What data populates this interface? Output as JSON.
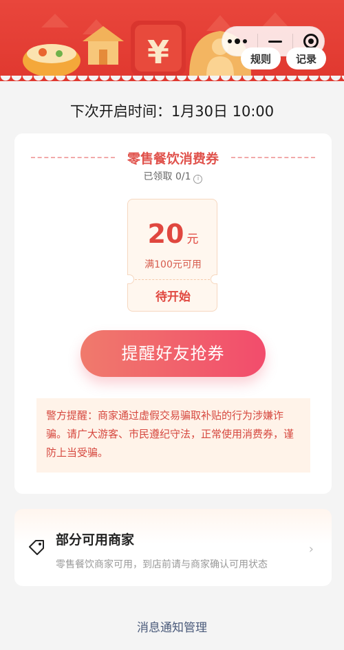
{
  "header": {
    "rules_label": "规则",
    "records_label": "记录",
    "menu_icon": "more-dots-icon",
    "minimize_icon": "minimize-icon",
    "close_icon": "target-icon"
  },
  "schedule": {
    "next_open_time": "下次开启时间：1月30日 10:00"
  },
  "coupon_card": {
    "title": "零售餐饮消费券",
    "claimed": "已领取 0/1",
    "coupon": {
      "amount": "20",
      "unit": "元",
      "condition": "满100元可用",
      "status": "待开始"
    },
    "remind_button": "提醒好友抢券",
    "warning": "警方提醒：商家通过虚假交易骗取补贴的行为涉嫌诈骗。请广大游客、市民遵纪守法，正常使用消费券，谨防上当受骗。"
  },
  "merchants": {
    "title": "部分可用商家",
    "description": "零售餐饮商家可用，到店前请与商家确认可用状态",
    "icon": "tag-icon"
  },
  "footer": {
    "message_manage": "消息通知管理"
  },
  "colors": {
    "banner_red": "#e9463c",
    "accent_red": "#e0473f",
    "button_gradient_start": "#f07a6c",
    "button_gradient_end": "#f24c6c"
  }
}
